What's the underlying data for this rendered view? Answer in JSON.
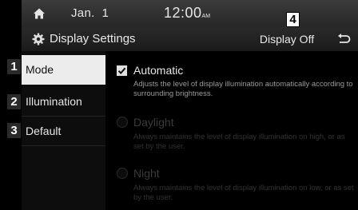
{
  "statusbar": {
    "date": "Jan.  1",
    "time": "12:00",
    "ampm": "AM"
  },
  "header": {
    "title": "Display Settings",
    "display_off_label": "Display Off"
  },
  "sidebar": {
    "items": [
      {
        "label": "Mode",
        "callout": "1",
        "active": true
      },
      {
        "label": "Illumination",
        "callout": "2",
        "active": false
      },
      {
        "label": "Default",
        "callout": "3",
        "active": false
      }
    ]
  },
  "callouts": {
    "display_off": "4"
  },
  "options": [
    {
      "title": "Automatic",
      "description": "Adjusts the level of display illumination automatically according to surrounding brightness.",
      "control": "checkbox",
      "checked": true,
      "enabled": true
    },
    {
      "title": "Daylight",
      "description": "Always maintains the level of display illumination on high, or as set by the user.",
      "control": "radio",
      "checked": false,
      "enabled": false
    },
    {
      "title": "Night",
      "description": "Always maintains the level of display illumination on low, or as set by the user.",
      "control": "radio",
      "checked": false,
      "enabled": false
    }
  ],
  "icons": [
    "home-icon",
    "gear-icon",
    "back-arrow-icon",
    "checkmark-icon"
  ],
  "colors": {
    "background": "#000000",
    "active_tab": "#ececec",
    "text": "#e6e6e6",
    "disabled_text": "#3a3a3a"
  }
}
